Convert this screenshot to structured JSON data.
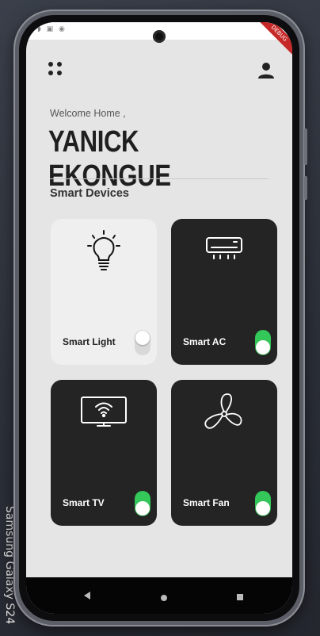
{
  "device_label": "Samsung Galaxy S24",
  "header": {
    "welcome_text": "Welcome Home ,",
    "username": "YANICK EKONGUE"
  },
  "section": {
    "title": "Smart Devices"
  },
  "devices": [
    {
      "name": "Smart Light",
      "icon": "lightbulb-icon",
      "power_on": false
    },
    {
      "name": "Smart AC",
      "icon": "air-conditioner-icon",
      "power_on": true
    },
    {
      "name": "Smart TV",
      "icon": "smart-tv-icon",
      "power_on": true
    },
    {
      "name": "Smart Fan",
      "icon": "fan-icon",
      "power_on": true
    }
  ],
  "colors": {
    "background": "#e5e5e5",
    "card_dark": "#242424",
    "card_light": "#efefef",
    "toggle_on": "#34c759"
  },
  "status_bar": {
    "debug_banner": "DEBUG"
  }
}
